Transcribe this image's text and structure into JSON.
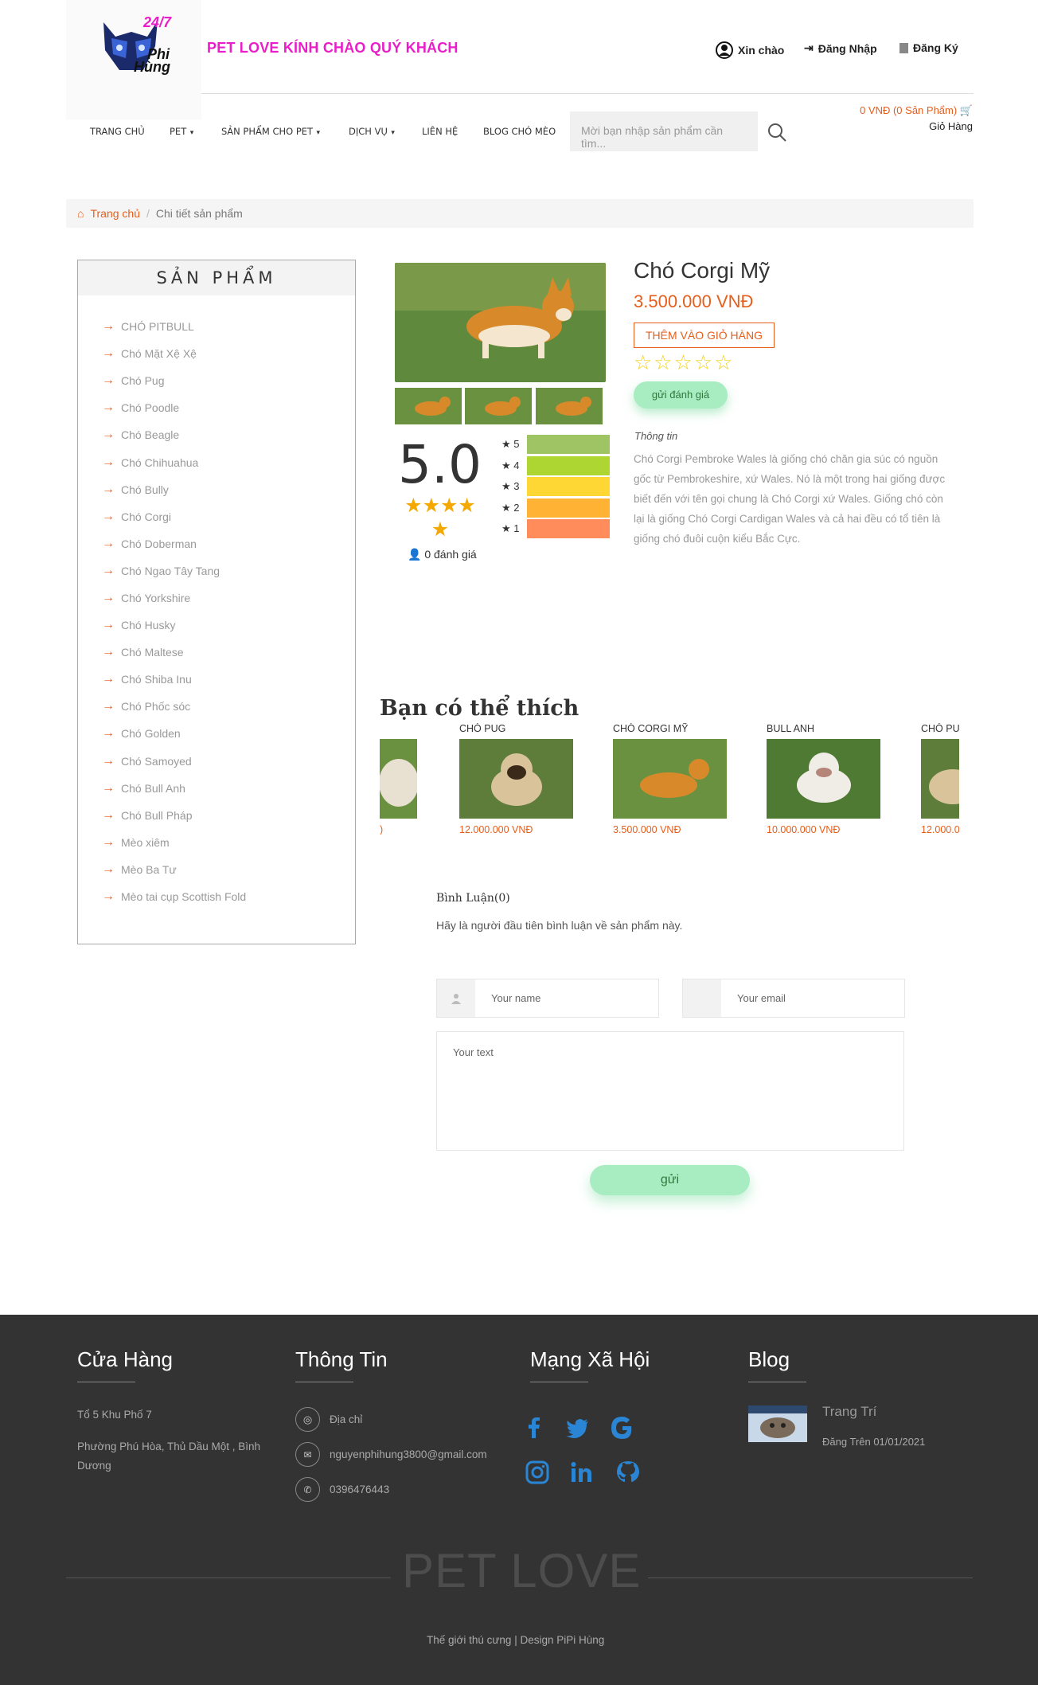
{
  "header": {
    "logo_text_1": "24/7",
    "logo_text_2": "Phi",
    "logo_text_3": "Hùng",
    "welcome": "PET LOVE KÍNH CHÀO QUÝ KHÁCH",
    "hello": "Xin chào",
    "login": "Đăng Nhập",
    "register": "Đăng Ký"
  },
  "nav": {
    "items": [
      "TRANG CHỦ",
      "PET",
      "SẢN PHẨM CHO PET",
      "DỊCH VỤ",
      "LIÊN HỆ",
      "BLOG CHÓ MÈO"
    ],
    "search_placeholder": "Mời bạn nhập sản phẩm cần tìm...",
    "cart_summary": "0 VNĐ (0 Sản Phẩm)",
    "cart_label": "Giỏ Hàng"
  },
  "breadcrumb": {
    "home": "Trang chủ",
    "current": "Chi tiết sản phẩm"
  },
  "sidebar": {
    "title": "SẢN PHẨM",
    "items": [
      "CHÓ PITBULL",
      "Chó Mặt Xệ Xệ",
      "Chó Pug",
      "Chó Poodle",
      "Chó Beagle",
      "Chó Chihuahua",
      "Chó Bully",
      "Chó Corgi",
      "Chó Doberman",
      "Chó Ngao Tây Tang",
      "Chó Yorkshire",
      "Chó Husky",
      "Chó Maltese",
      "Chó Shiba Inu",
      "Chó Phốc sóc",
      "Chó Golden",
      "Chó Samoyed",
      "Chó Bull Anh",
      "Chó Bull Pháp",
      "Mèo xiêm",
      "Mèo Ba Tư",
      "Mèo tai cụp Scottish Fold"
    ]
  },
  "product": {
    "name": "Chó Corgi Mỹ",
    "price": "3.500.000  VNĐ",
    "add_to_cart": "THÊM VÀO GIỎ HÀNG",
    "rate_button": "gửi đánh giá",
    "info_label": "Thông tin",
    "info_text": "Chó Corgi Pembroke Wales là giống chó chăn gia súc có nguồn gốc từ Pembrokeshire, xứ Wales. Nó là một trong hai giống được biết đến với tên gọi chung là Chó Corgi xứ Wales. Giống chó còn lại là giống Chó Corgi Cardigan Wales và cả hai đều có tổ tiên là giống chó đuôi cuộn kiểu Bắc Cực."
  },
  "rating": {
    "score": "5.0",
    "count": "0 đánh giá",
    "levels": [
      "5",
      "4",
      "3",
      "2",
      "1"
    ],
    "colors": [
      "#9fc463",
      "#add633",
      "#ffd735",
      "#ffb234",
      "#ff8c5a"
    ]
  },
  "related": {
    "title": "Bạn có thể thích",
    "items": [
      {
        "name": "",
        "price": ")"
      },
      {
        "name": "CHÓ PUG",
        "price": "12.000.000  VNĐ"
      },
      {
        "name": "CHÓ CORGI MỸ",
        "price": "3.500.000  VNĐ"
      },
      {
        "name": "BULL ANH",
        "price": "10.000.000  VNĐ"
      },
      {
        "name": "CHÓ PU",
        "price": "12.000.0"
      }
    ]
  },
  "comments": {
    "title": "Bình Luận(0)",
    "note": "Hãy là người đầu tiên bình luận về sản phẩm này.",
    "name_placeholder": "Your name",
    "email_placeholder": "Your email",
    "text_placeholder": "Your text",
    "send": "gửi"
  },
  "footer": {
    "store_title": "Cửa Hàng",
    "store_addr_1": "Tổ 5 Khu Phố 7",
    "store_addr_2": "Phường Phú Hòa, Thủ Dầu Một , Bình Dương",
    "info_title": "Thông Tin",
    "address": "Địa chỉ",
    "email": "nguyenphihung3800@gmail.com",
    "phone": "0396476443",
    "social_title": "Mạng Xã Hội",
    "blog_title": "Blog",
    "blog_post": "Trang Trí",
    "blog_date": "Đăng Trên 01/01/2021",
    "brand": "PET LOVE",
    "copyright": "Thế giới thú cưng | Design PiPi Hùng"
  }
}
